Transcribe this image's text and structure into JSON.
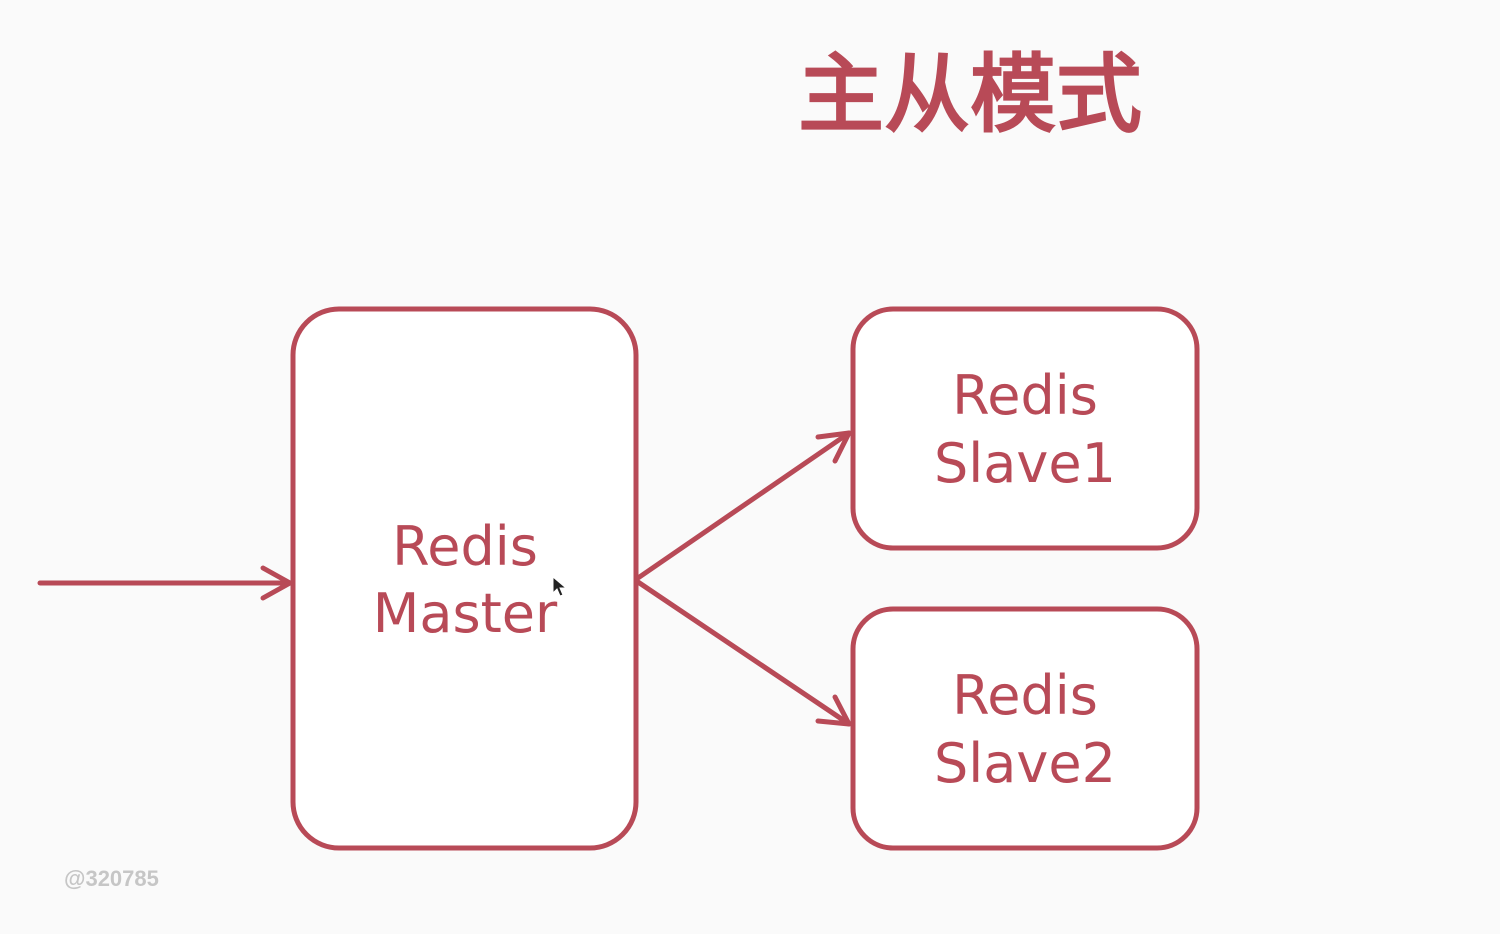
{
  "title": "主从模式",
  "master": {
    "line1": "Redis",
    "line2": "Master"
  },
  "slaves": [
    {
      "line1": "Redis",
      "line2": "Slave1"
    },
    {
      "line1": "Redis",
      "line2": "Slave2"
    }
  ],
  "watermark": "@320785",
  "colors": {
    "accent": "#b84a57",
    "background": "#fafafa",
    "watermark": "#c6c6c6"
  },
  "icons": {
    "cursor": "mouse-pointer-icon"
  }
}
